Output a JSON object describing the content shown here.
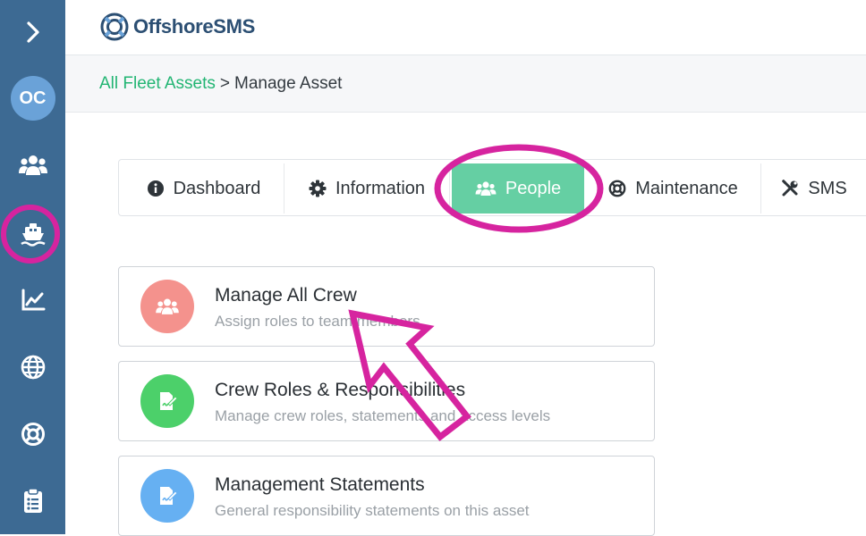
{
  "sidebar": {
    "avatar_initials": "OC",
    "items": [
      {
        "icon": "chevron-right-icon"
      },
      {
        "icon": "user-avatar"
      },
      {
        "icon": "users-icon"
      },
      {
        "icon": "ship-icon",
        "highlighted": true
      },
      {
        "icon": "chart-line-icon"
      },
      {
        "icon": "globe-icon"
      },
      {
        "icon": "life-ring-icon"
      },
      {
        "icon": "clipboard-list-icon"
      }
    ]
  },
  "header": {
    "brand": "OffshoreSMS"
  },
  "breadcrumb": {
    "link": "All Fleet Assets",
    "separator": ">",
    "current": "Manage Asset"
  },
  "tabs": [
    {
      "label": "Dashboard",
      "icon": "info-circle-icon",
      "active": false
    },
    {
      "label": "Information",
      "icon": "cog-icon",
      "active": false
    },
    {
      "label": "People",
      "icon": "users-icon",
      "active": true
    },
    {
      "label": "Maintenance",
      "icon": "life-ring-icon",
      "active": false
    },
    {
      "label": "SMS",
      "icon": "tools-icon",
      "active": false
    }
  ],
  "cards": [
    {
      "title": "Manage All Crew",
      "subtitle": "Assign roles to team members",
      "icon_color": "#f4928d"
    },
    {
      "title": "Crew Roles & Responsibilities",
      "subtitle": "Manage crew roles, statements and access levels",
      "icon_color": "#4cd06a"
    },
    {
      "title": "Management Statements",
      "subtitle": "General responsibility statements on this asset",
      "icon_color": "#66b0f2"
    }
  ],
  "colors": {
    "sidebar_bg": "#3d6a93",
    "accent_green": "#22b573",
    "active_tab": "#65cfa3",
    "annotation_magenta": "#d6249f"
  }
}
